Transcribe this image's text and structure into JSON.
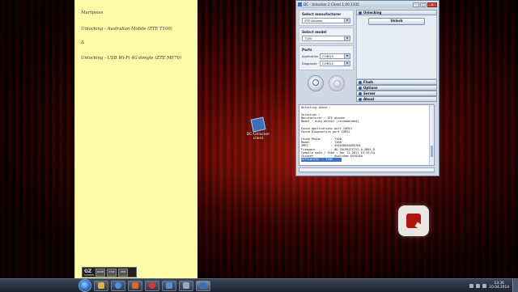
{
  "sticky_note": {
    "lines": [
      "Murtpoiss",
      "Unlocking - Australian Mobile (ZTE T100)",
      "&",
      "Unlocking - USB Wi-Fi 4G dongle (ZTE MF70)"
    ]
  },
  "screen_recorder": {
    "logo": "GZ",
    "logo_sub": "SCREEN",
    "buttons": [
      "PAUSE",
      "STOP",
      "HIDE"
    ]
  },
  "desktop_icon": {
    "label": "DC-Unlocker client"
  },
  "window": {
    "title": "DC - Unlocker 2 Client 1.00.1335",
    "controls": {
      "minimize": "–",
      "maximize": "□",
      "close": "x"
    },
    "select_manufacturer": {
      "heading": "Select manufacturer",
      "value": "ZTE phones"
    },
    "select_model": {
      "heading": "Select model",
      "value": "T100"
    },
    "ports": {
      "heading": "Ports",
      "application_label": "Application",
      "application_value": "COM13",
      "diagnostic_label": "Diagnostic",
      "diagnostic_value": "COM12"
    },
    "sections": {
      "unlocking": "Unlocking",
      "unlock_button": "Unlock",
      "flash": "Flash",
      "options": "Options",
      "server": "Server",
      "about": "About"
    },
    "log": [
      "Detecting phone :",
      "",
      "Selection :",
      "Manufacturer : ZTE phones",
      "Model : Auto detect (recommended)",
      "",
      "Found Applications port COM13",
      "Found Diagnostics port COM12",
      "",
      "Found Phone      : T100",
      "Model            : T100",
      "IMEI             : 354030044692764",
      "Firmware         : BD_T6LP6ZTCTV1.0.2B03-D",
      "Compile date / time : Apr 11 2011 15:19:54",
      "Chipset          : Qualcomm QSC6240",
      "SoftwareID  : T100",
      "",
      "================================================"
    ]
  },
  "taskbar": {
    "clock_time": "13:36",
    "clock_date": "10.04.2014"
  },
  "colors": {
    "accent": "#2b57a1",
    "sticky_note": "#fdfba8",
    "desktop_red": "#b0160e"
  }
}
